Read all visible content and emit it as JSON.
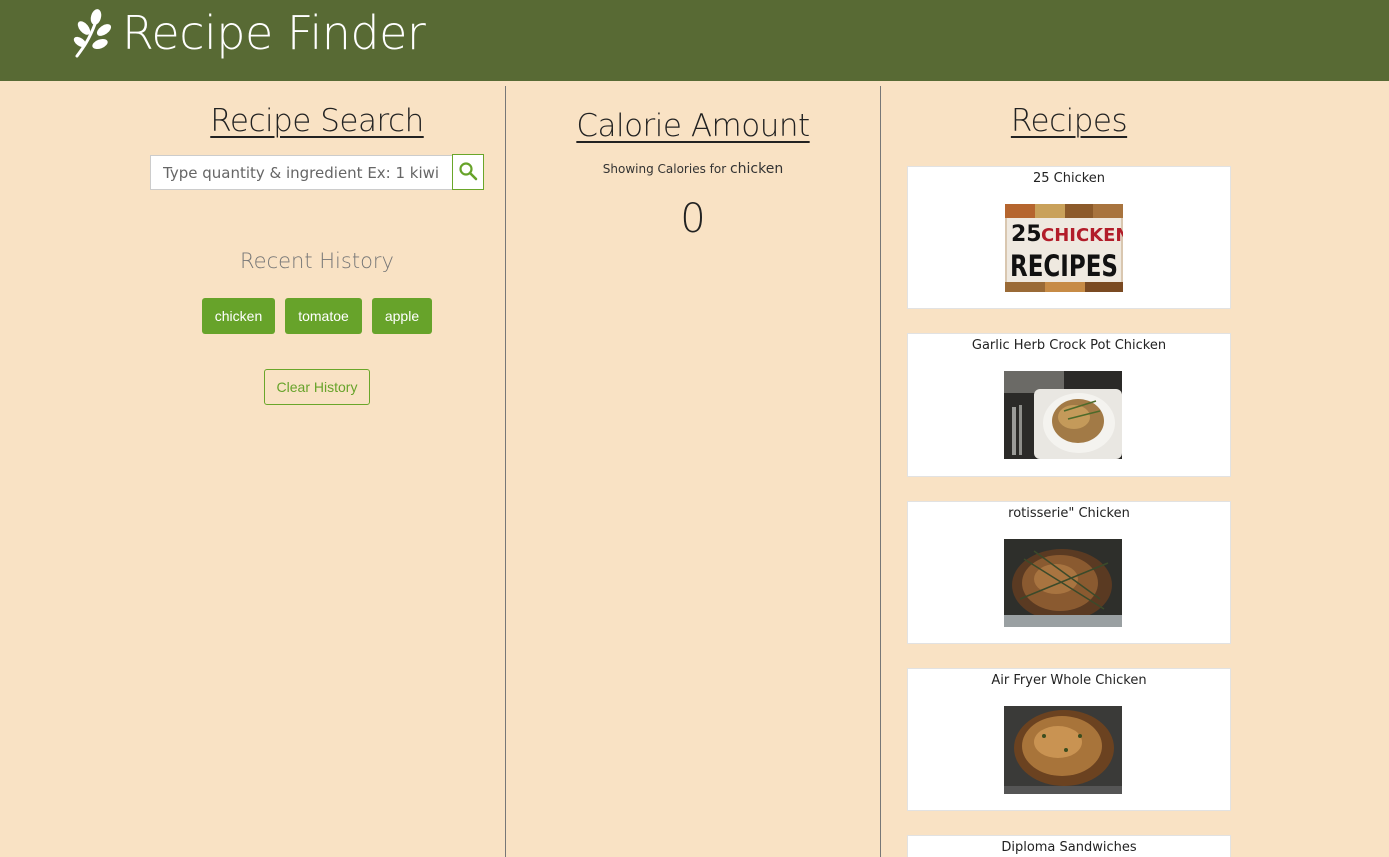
{
  "header": {
    "app_title": "Recipe Finder",
    "logo_icon": "leaf-branch-icon",
    "bg_color": "#586a34"
  },
  "search_panel": {
    "title": "Recipe Search",
    "search_placeholder": "Type quantity & ingredient Ex: 1 kiwi",
    "search_icon": "search-icon",
    "history_title": "Recent History",
    "history_items": [
      "chicken",
      "tomatoe",
      "apple"
    ],
    "clear_label": "Clear History",
    "accent_color": "#67a32a"
  },
  "calorie_panel": {
    "title": "Calorie Amount",
    "subtitle_prefix": "Showing Calories for",
    "query": "chicken",
    "value": "0"
  },
  "recipes_panel": {
    "title": "Recipes",
    "cards": [
      {
        "title": "25 Chicken",
        "image_text_1": "25",
        "image_text_2": "CHICKEN",
        "image_text_3": "RECIPES"
      },
      {
        "title": "Garlic Herb Crock Pot Chicken"
      },
      {
        "title": "rotisserie\" Chicken"
      },
      {
        "title": "Air Fryer Whole Chicken"
      },
      {
        "title": "Diploma Sandwiches"
      }
    ]
  },
  "page_background": "#f9e2c4"
}
